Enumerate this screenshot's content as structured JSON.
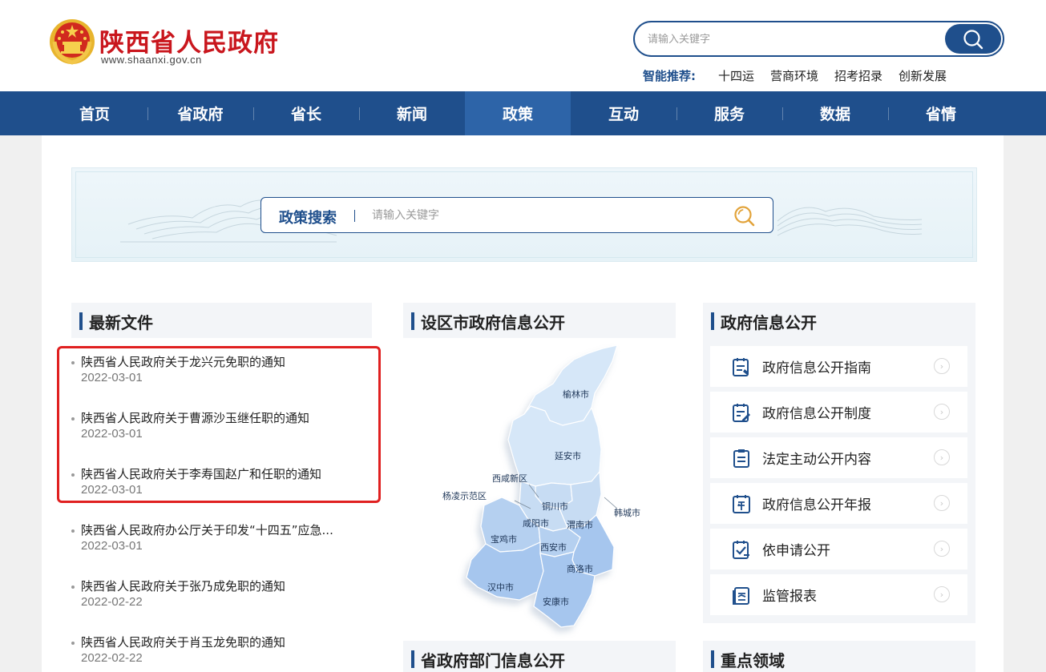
{
  "header": {
    "site_title": "陕西省人民政府",
    "site_url": "www.shaanxi.gov.cn",
    "search_placeholder": "请输入关键字",
    "recommend_label": "智能推荐:",
    "recommend_items": [
      "十四运",
      "营商环境",
      "招考招录",
      "创新发展"
    ]
  },
  "nav": {
    "items": [
      "首页",
      "省政府",
      "省长",
      "新闻",
      "政策",
      "互动",
      "服务",
      "数据",
      "省情"
    ],
    "active": "政策"
  },
  "policy_search": {
    "label": "政策搜索",
    "placeholder": "请输入关键字"
  },
  "sections": {
    "latest_files": "最新文件",
    "city_info": "设区市政府信息公开",
    "gov_info": "政府信息公开",
    "dept_info": "省政府部门信息公开",
    "key_areas": "重点领域"
  },
  "latest_files": [
    {
      "title": "陕西省人民政府关于龙兴元免职的通知",
      "date": "2022-03-01"
    },
    {
      "title": "陕西省人民政府关于曹源沙玉继任职的通知",
      "date": "2022-03-01"
    },
    {
      "title": "陕西省人民政府关于李寿国赵广和任职的通知",
      "date": "2022-03-01"
    },
    {
      "title": "陕西省人民政府办公厅关于印发“十四五”应急...",
      "date": "2022-03-01"
    },
    {
      "title": "陕西省人民政府关于张乃成免职的通知",
      "date": "2022-02-22"
    },
    {
      "title": "陕西省人民政府关于肖玉龙免职的通知",
      "date": "2022-02-22"
    }
  ],
  "map_cities": {
    "yulin": "榆林市",
    "yanan": "延安市",
    "xixian": "西咸新区",
    "yangling": "杨凌示范区",
    "tongchuan": "铜川市",
    "hancheng": "韩城市",
    "xianyang": "咸阳市",
    "weinan": "渭南市",
    "baoji": "宝鸡市",
    "xian": "西安市",
    "shangluo": "商洛市",
    "hanzhong": "汉中市",
    "ankang": "安康市"
  },
  "gov_info_items": [
    {
      "label": "政府信息公开指南",
      "icon": "guide-icon"
    },
    {
      "label": "政府信息公开制度",
      "icon": "system-edit-icon"
    },
    {
      "label": "法定主动公开内容",
      "icon": "list-clipboard-icon"
    },
    {
      "label": "政府信息公开年报",
      "icon": "annual-report-icon"
    },
    {
      "label": "依申请公开",
      "icon": "apply-check-icon"
    },
    {
      "label": "监管报表",
      "icon": "report-icon"
    }
  ],
  "colors": {
    "brand_red": "#c9161d",
    "nav_blue": "#1f4f8c",
    "nav_active": "#2d64a8",
    "highlight": "#e02020"
  }
}
